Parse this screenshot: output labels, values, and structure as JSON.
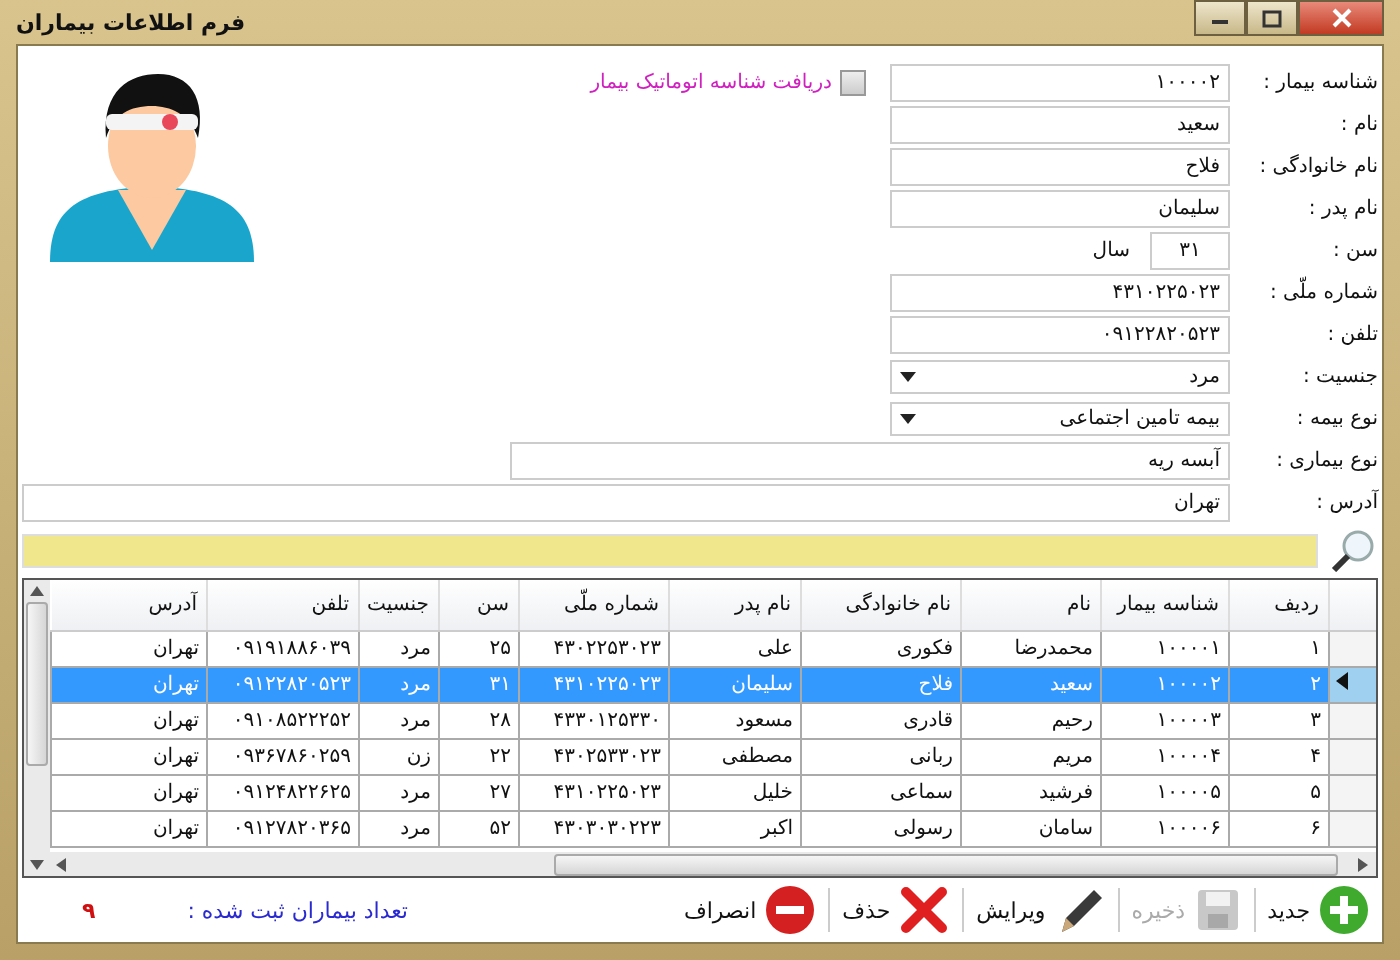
{
  "window": {
    "title": "فرم اطلاعات بیماران"
  },
  "form": {
    "fields": [
      {
        "label": "شناسه بیمار :",
        "value": "۱۰۰۰۰۲",
        "kind": "text"
      },
      {
        "label": "نام :",
        "value": "سعید",
        "kind": "text"
      },
      {
        "label": "نام خانوادگی :",
        "value": "فلاح",
        "kind": "text"
      },
      {
        "label": "نام پدر :",
        "value": "سلیمان",
        "kind": "text"
      },
      {
        "label": "سن :",
        "value": "۳۱",
        "kind": "age",
        "suffix": "سال"
      },
      {
        "label": "شماره ملّی :",
        "value": "۴۳۱۰۲۲۵۰۲۳",
        "kind": "text"
      },
      {
        "label": "تلفن :",
        "value": "۰۹۱۲۲۸۲۰۵۲۳",
        "kind": "text"
      },
      {
        "label": "جنسیت :",
        "value": "مرد",
        "kind": "select"
      },
      {
        "label": "نوع بیمه :",
        "value": "بیمه تامین اجتماعی",
        "kind": "select"
      },
      {
        "label": "نوع بیماری :",
        "value": "آبسه ریه",
        "kind": "wide"
      },
      {
        "label": "آدرس :",
        "value": "تهران",
        "kind": "full"
      }
    ],
    "auto_id": {
      "label": "دریافت شناسه اتوماتیک بیمار",
      "checked": false
    }
  },
  "table": {
    "columns": [
      "ردیف",
      "شناسه بیمار",
      "نام",
      "نام خانوادگی",
      "نام پدر",
      "شماره ملّی",
      "سن",
      "جنسیت",
      "تلفن",
      "آدرس"
    ],
    "rows": [
      {
        "cells": [
          "۱",
          "۱۰۰۰۰۱",
          "محمدرضا",
          "فکوری",
          "علی",
          "۴۳۰۲۲۵۳۰۲۳",
          "۲۵",
          "مرد",
          "۰۹۱۹۱۸۸۶۰۳۹",
          "تهران"
        ],
        "selected": false
      },
      {
        "cells": [
          "۲",
          "۱۰۰۰۰۲",
          "سعید",
          "فلاح",
          "سلیمان",
          "۴۳۱۰۲۲۵۰۲۳",
          "۳۱",
          "مرد",
          "۰۹۱۲۲۸۲۰۵۲۳",
          "تهران"
        ],
        "selected": true
      },
      {
        "cells": [
          "۳",
          "۱۰۰۰۰۳",
          "رحیم",
          "قادری",
          "مسعود",
          "۴۳۳۰۱۲۵۳۳۰",
          "۲۸",
          "مرد",
          "۰۹۱۰۸۵۲۲۲۵۲",
          "تهران"
        ],
        "selected": false
      },
      {
        "cells": [
          "۴",
          "۱۰۰۰۰۴",
          "مریم",
          "ربانی",
          "مصطفی",
          "۴۳۰۲۵۳۳۰۲۳",
          "۲۲",
          "زن",
          "۰۹۳۶۷۸۶۰۲۵۹",
          "تهران"
        ],
        "selected": false
      },
      {
        "cells": [
          "۵",
          "۱۰۰۰۰۵",
          "فرشید",
          "سماعی",
          "خلیل",
          "۴۳۱۰۲۲۵۰۲۳",
          "۲۷",
          "مرد",
          "۰۹۱۲۴۸۲۲۶۲۵",
          "تهران"
        ],
        "selected": false
      },
      {
        "cells": [
          "۶",
          "۱۰۰۰۰۶",
          "سامان",
          "رسولی",
          "اکبر",
          "۴۳۰۳۰۳۰۲۲۳",
          "۵۲",
          "مرد",
          "۰۹۱۲۷۸۲۰۳۶۵",
          "تهران"
        ],
        "selected": false
      }
    ]
  },
  "toolbar": {
    "buttons": [
      {
        "label": "جدید",
        "kind": "new",
        "disabled": false
      },
      {
        "label": "ذخیره",
        "kind": "save",
        "disabled": true
      },
      {
        "label": "ویرایش",
        "kind": "edit",
        "disabled": false
      },
      {
        "label": "حذف",
        "kind": "delete",
        "disabled": false
      },
      {
        "label": "انصراف",
        "kind": "cancel",
        "disabled": false
      }
    ],
    "count": {
      "label": "تعداد بیماران ثبت شده :",
      "value": "۹"
    }
  }
}
